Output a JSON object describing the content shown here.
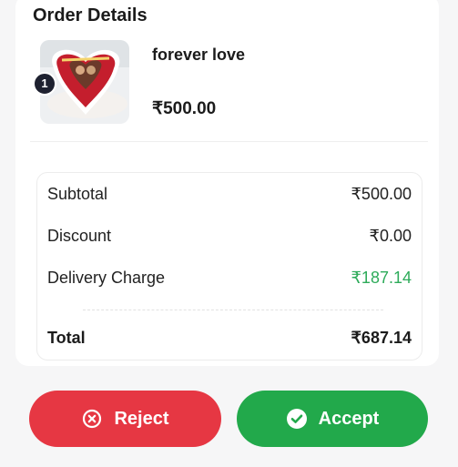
{
  "order": {
    "title": "Order Details",
    "item": {
      "name": "forever love",
      "price": "₹500.00",
      "quantity": "1",
      "image_icon": "cake-photo-image"
    }
  },
  "summary": {
    "subtotal_label": "Subtotal",
    "subtotal_value": "₹500.00",
    "discount_label": "Discount",
    "discount_value": "₹0.00",
    "delivery_label": "Delivery Charge",
    "delivery_value": "₹187.14",
    "total_label": "Total",
    "total_value": "₹687.14"
  },
  "actions": {
    "reject_label": "Reject",
    "reject_icon": "x-circle-icon",
    "accept_label": "Accept",
    "accept_icon": "check-circle-icon"
  },
  "colors": {
    "reject": "#e63743",
    "accept": "#22a94b",
    "delivery_value": "#2eab5a"
  }
}
